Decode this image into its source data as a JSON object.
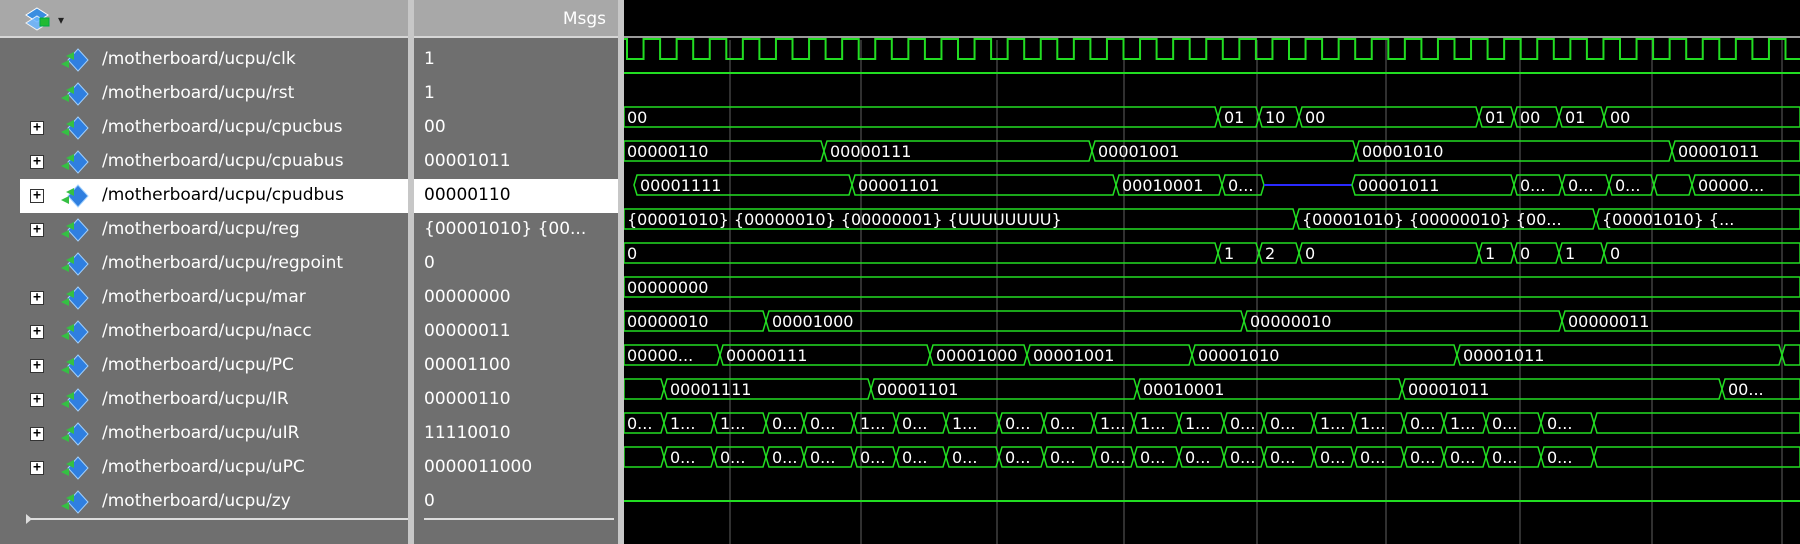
{
  "toolbar": {
    "icon": "wave-layout-icon",
    "arrow": "▾"
  },
  "values_header": {
    "label": "Msgs"
  },
  "colors": {
    "pane": "#6f6f6f",
    "header": "#a8a8a8",
    "wave": "#22dd22",
    "cursor": "#5f5f5f",
    "highz": "#2a2aff"
  },
  "signals": [
    {
      "name": "/motherboard/ucpu/clk",
      "value": "1",
      "expandable": false,
      "selected": false
    },
    {
      "name": "/motherboard/ucpu/rst",
      "value": "1",
      "expandable": false,
      "selected": false
    },
    {
      "name": "/motherboard/ucpu/cpucbus",
      "value": "00",
      "expandable": true,
      "selected": false
    },
    {
      "name": "/motherboard/ucpu/cpuabus",
      "value": "00001011",
      "expandable": true,
      "selected": false
    },
    {
      "name": "/motherboard/ucpu/cpudbus",
      "value": "00000110",
      "expandable": true,
      "selected": true
    },
    {
      "name": "/motherboard/ucpu/reg",
      "value": "{00001010} {00...",
      "expandable": true,
      "selected": false
    },
    {
      "name": "/motherboard/ucpu/regpoint",
      "value": "0",
      "expandable": false,
      "selected": false
    },
    {
      "name": "/motherboard/ucpu/mar",
      "value": "00000000",
      "expandable": true,
      "selected": false
    },
    {
      "name": "/motherboard/ucpu/nacc",
      "value": "00000011",
      "expandable": true,
      "selected": false
    },
    {
      "name": "/motherboard/ucpu/PC",
      "value": "00001100",
      "expandable": true,
      "selected": false
    },
    {
      "name": "/motherboard/ucpu/IR",
      "value": "00000110",
      "expandable": true,
      "selected": false
    },
    {
      "name": "/motherboard/ucpu/uIR",
      "value": "11110010",
      "expandable": true,
      "selected": false
    },
    {
      "name": "/motherboard/ucpu/uPC",
      "value": "0000011000",
      "expandable": true,
      "selected": false
    },
    {
      "name": "/motherboard/ucpu/zy",
      "value": "0",
      "expandable": false,
      "selected": false
    }
  ],
  "waves": {
    "cpucbus": [
      [
        "00",
        "00"
      ],
      [
        "01",
        "01"
      ],
      [
        "10",
        "10"
      ],
      [
        "00",
        "00"
      ],
      [
        "01",
        "01"
      ],
      [
        "00",
        "00"
      ],
      [
        "01",
        "01"
      ],
      [
        "00",
        "00"
      ]
    ],
    "cpuabus": [
      [
        "00000110",
        "00000110"
      ],
      [
        "00000111",
        "00000111"
      ],
      [
        "00001001",
        "00001001"
      ],
      [
        "00001010",
        "00001010"
      ],
      [
        "00001011",
        "00001011"
      ]
    ],
    "cpudbus": [
      [
        "00001111",
        "00001111"
      ],
      [
        "00001101",
        "00001101"
      ],
      [
        "00010001",
        "00010001"
      ],
      [
        "0...",
        "0..."
      ],
      [
        "",
        ""
      ],
      [
        "00001011",
        "00001011"
      ],
      [
        "0...",
        "0..."
      ],
      [
        "0...",
        "0..."
      ],
      [
        "0...",
        "0..."
      ],
      [
        "",
        ""
      ],
      [
        "00000...",
        "00000..."
      ]
    ],
    "reg": [
      [
        "{00001010} {00000010} {00000001} {UUUUUUUU}",
        "{00001010} {00000010} {00000001} {UUUUUUUU}"
      ],
      [
        "{00001010} {00000010} {00...",
        "{00001010} {00000010} {00..."
      ],
      [
        "{00001010} {...",
        "{00001010} {..."
      ]
    ],
    "regpoint": [
      [
        "0",
        "0"
      ],
      [
        "1",
        "1"
      ],
      [
        "2",
        "2"
      ],
      [
        "0",
        "0"
      ],
      [
        "1",
        "1"
      ],
      [
        "0",
        "0"
      ],
      [
        "1",
        "1"
      ],
      [
        "0",
        "0"
      ]
    ],
    "mar": [
      [
        "00000000",
        "00000000"
      ]
    ],
    "nacc": [
      [
        "00000010",
        "00000010"
      ],
      [
        "00001000",
        "00001000"
      ],
      [
        "00000010",
        "00000010"
      ],
      [
        "00000011",
        "00000011"
      ]
    ],
    "PC": [
      [
        "00000...",
        "00000..."
      ],
      [
        "00000111",
        "00000111"
      ],
      [
        "00001000",
        "00001000"
      ],
      [
        "00001001",
        "00001001"
      ],
      [
        "00001010",
        "00001010"
      ],
      [
        "00001011",
        "00001011"
      ],
      [
        "",
        ""
      ]
    ],
    "IR": [
      [
        "",
        ""
      ],
      [
        "00001111",
        "00001111"
      ],
      [
        "00001101",
        "00001101"
      ],
      [
        "00010001",
        "00010001"
      ],
      [
        "00001011",
        "00001011"
      ],
      [
        "00...",
        "00..."
      ]
    ],
    "uIR": [
      [
        "0...",
        "0..."
      ],
      [
        "1...",
        "1..."
      ],
      [
        "1...",
        "1..."
      ],
      [
        "0...",
        "0..."
      ],
      [
        "0...",
        "0..."
      ],
      [
        "1...",
        "1..."
      ],
      [
        "0...",
        "0..."
      ],
      [
        "1...",
        "1..."
      ],
      [
        "0...",
        "0..."
      ],
      [
        "0...",
        "0..."
      ],
      [
        "1...",
        "1..."
      ],
      [
        "1...",
        "1..."
      ],
      [
        "1...",
        "1..."
      ],
      [
        "0...",
        "0..."
      ],
      [
        "0...",
        "0..."
      ],
      [
        "1...",
        "1..."
      ],
      [
        "1...",
        "1..."
      ],
      [
        "0...",
        "0..."
      ],
      [
        "1...",
        "1..."
      ],
      [
        "0...",
        "0..."
      ],
      [
        "0...",
        "0..."
      ],
      [
        "",
        ""
      ]
    ],
    "uPC": [
      [
        "",
        ""
      ],
      [
        "0...",
        "0..."
      ],
      [
        "0...",
        "0..."
      ],
      [
        "0...",
        "0..."
      ],
      [
        "0...",
        "0..."
      ],
      [
        "0...",
        "0..."
      ],
      [
        "0...",
        "0..."
      ],
      [
        "0...",
        "0..."
      ],
      [
        "0...",
        "0..."
      ],
      [
        "0...",
        "0..."
      ],
      [
        "0...",
        "0..."
      ],
      [
        "0...",
        "0..."
      ],
      [
        "0...",
        "0..."
      ],
      [
        "0...",
        "0..."
      ],
      [
        "0...",
        "0..."
      ],
      [
        "0...",
        "0..."
      ],
      [
        "0...",
        "0..."
      ],
      [
        "0...",
        "0..."
      ],
      [
        "0...",
        "0..."
      ],
      [
        "0...",
        "0..."
      ],
      [
        "0...",
        "0..."
      ],
      [
        "",
        ""
      ]
    ]
  }
}
